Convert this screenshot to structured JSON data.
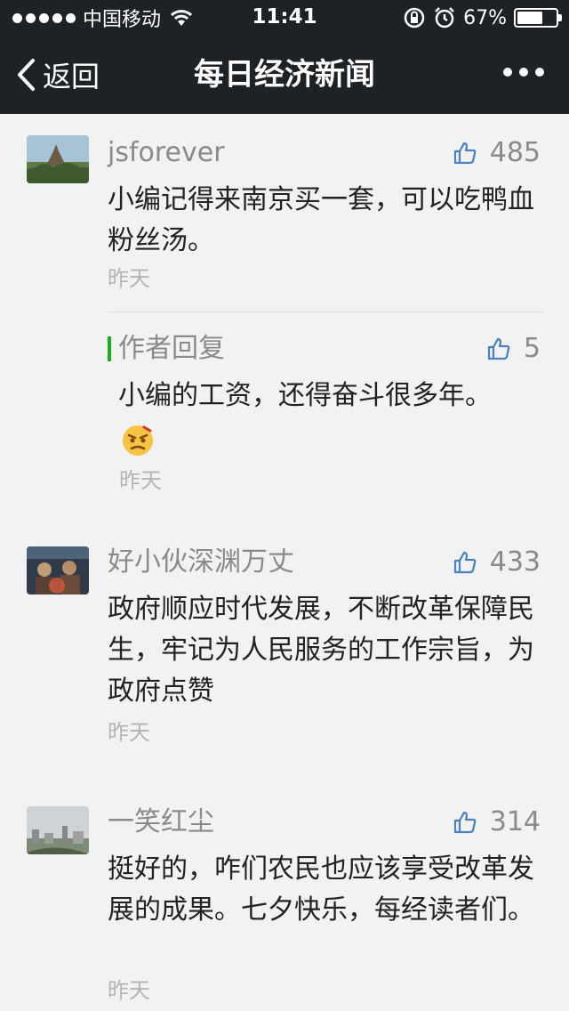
{
  "status": {
    "carrier": "中国移动",
    "time": "11:41",
    "battery": "67%",
    "battery_level": 0.67
  },
  "nav": {
    "back_label": "返回",
    "title": "每日经济新闻"
  },
  "comments": [
    {
      "user": "jsforever",
      "likes": "485",
      "text": "小编记得来南京买一套，可以吃鸭血粉丝汤。",
      "time": "昨天",
      "reply": {
        "label": "作者回复",
        "likes": "5",
        "text": "小编的工资，还得奋斗很多年。",
        "time": "昨天"
      }
    },
    {
      "user": "好小伙深渊万丈",
      "likes": "433",
      "text": "政府顺应时代发展，不断改革保障民生，牢记为人民服务的工作宗旨，为政府点赞",
      "time": "昨天"
    },
    {
      "user": "一笑红尘",
      "likes": "314",
      "text": "挺好的，咋们农民也应该享受改革发展的成果。七夕快乐，每经读者们。",
      "time": "昨天"
    }
  ],
  "colors": {
    "topbar": "#1f2225",
    "background": "#f2f2f2",
    "accent_green": "#1aad19",
    "like_blue": "#4a7fc1"
  },
  "icons": [
    "signal-dots-icon",
    "wifi-icon",
    "rotation-lock-icon",
    "alarm-icon",
    "battery-icon",
    "back-chevron-icon",
    "more-icon",
    "thumbs-up-icon",
    "angry-emoji-icon"
  ]
}
